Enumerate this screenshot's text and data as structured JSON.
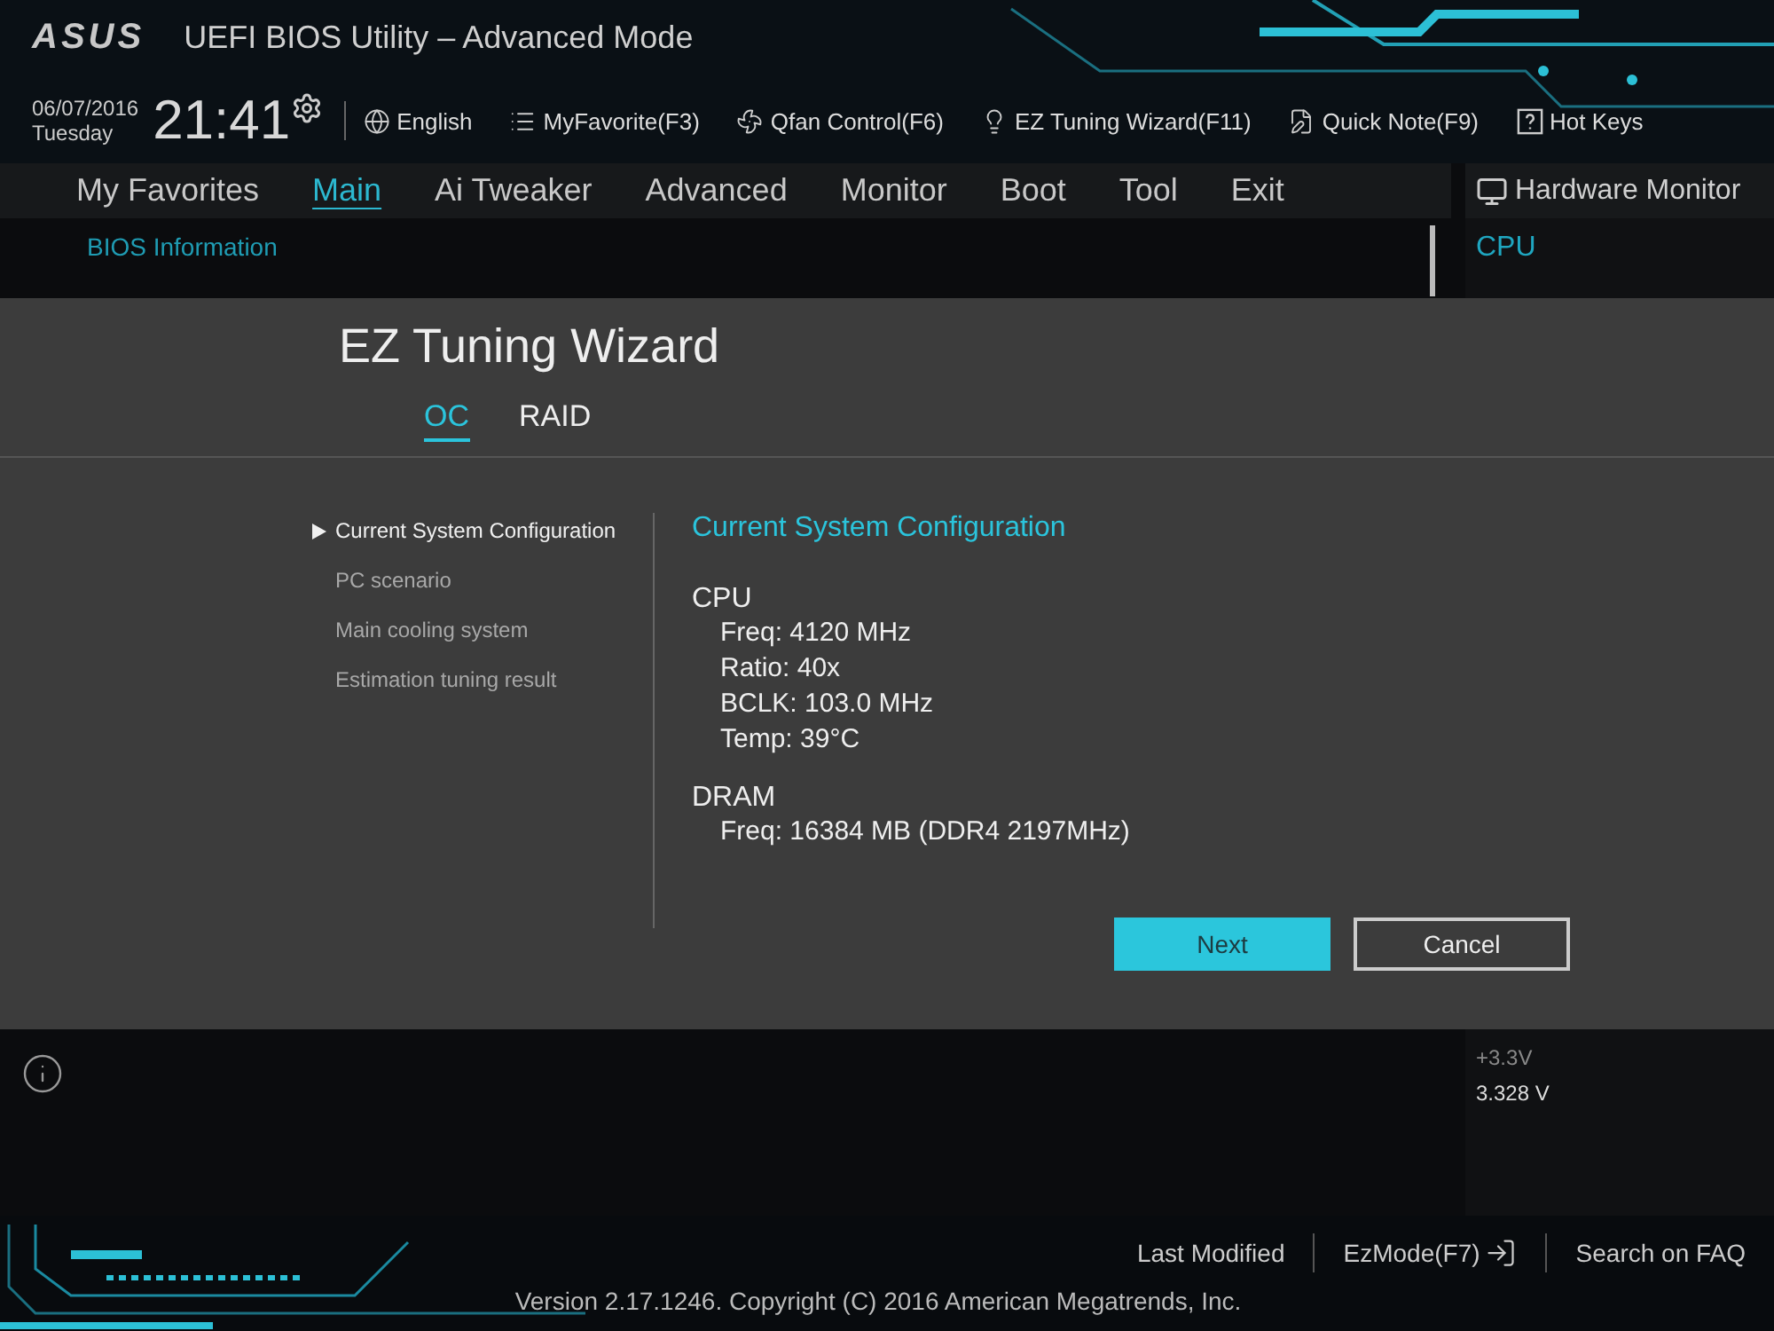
{
  "header": {
    "logo": "ASUS",
    "title": "UEFI BIOS Utility – Advanced Mode",
    "date": "06/07/2016",
    "day": "Tuesday",
    "time": "21:41",
    "toolbar": [
      {
        "label": "English",
        "kind": "globe"
      },
      {
        "label": "MyFavorite(F3)",
        "kind": "favorite"
      },
      {
        "label": "Qfan Control(F6)",
        "kind": "fan"
      },
      {
        "label": "EZ Tuning Wizard(F11)",
        "kind": "bulb"
      },
      {
        "label": "Quick Note(F9)",
        "kind": "note"
      },
      {
        "label": "Hot Keys",
        "kind": "help"
      }
    ]
  },
  "nav": {
    "tabs": [
      {
        "label": "My Favorites",
        "selected": false
      },
      {
        "label": "Main",
        "selected": true
      },
      {
        "label": "Ai Tweaker",
        "selected": false
      },
      {
        "label": "Advanced",
        "selected": false
      },
      {
        "label": "Monitor",
        "selected": false
      },
      {
        "label": "Boot",
        "selected": false
      },
      {
        "label": "Tool",
        "selected": false
      },
      {
        "label": "Exit",
        "selected": false
      }
    ]
  },
  "content": {
    "section": "BIOS Information"
  },
  "hardware_monitor": {
    "title": "Hardware Monitor",
    "section": "CPU",
    "readings": [
      {
        "label": "+3.3V",
        "value": "3.328 V"
      }
    ]
  },
  "wizard": {
    "title": "EZ Tuning Wizard",
    "tabs": [
      {
        "label": "OC",
        "selected": true
      },
      {
        "label": "RAID",
        "selected": false
      }
    ],
    "steps": [
      {
        "label": "Current System Configuration",
        "selected": true
      },
      {
        "label": "PC scenario",
        "selected": false
      },
      {
        "label": "Main cooling system",
        "selected": false
      },
      {
        "label": "Estimation tuning result",
        "selected": false
      }
    ],
    "heading": "Current System Configuration",
    "groups": [
      {
        "name": "CPU",
        "lines": [
          "Freq: 4120 MHz",
          "Ratio: 40x",
          "BCLK: 103.0 MHz",
          "Temp: 39°C"
        ]
      },
      {
        "name": "DRAM",
        "lines": [
          "Freq: 16384 MB (DDR4 2197MHz)"
        ]
      }
    ],
    "buttons": [
      {
        "label": "Next",
        "kind": "primary"
      },
      {
        "label": "Cancel",
        "kind": "secondary"
      }
    ]
  },
  "footer": {
    "links": [
      {
        "label": "Last Modified",
        "kind": "plain"
      },
      {
        "label": "EzMode(F7)",
        "kind": "exit"
      },
      {
        "label": "Search on FAQ",
        "kind": "plain"
      }
    ],
    "version": "Version 2.17.1246. Copyright (C) 2016 American Megatrends, Inc."
  }
}
